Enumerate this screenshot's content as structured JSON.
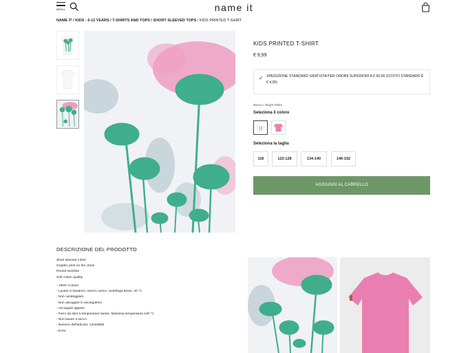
{
  "header": {
    "menu_label": "MENU",
    "logo": "name it",
    "icons": {
      "menu": "hamburger-icon",
      "search": "search-icon",
      "bag": "shopping-bag-icon"
    }
  },
  "breadcrumb": {
    "items": [
      "NAME IT",
      "KIDS - 6-12 YEARS",
      "T-SHIRTS AND TOPS",
      "SHORT SLEEVED TOPS"
    ],
    "current": "KIDS PRINTED T-SHIRT",
    "separator": " / "
  },
  "product": {
    "title": "KIDS PRINTED T-SHIRT",
    "price": "€ 9,99",
    "shipping_note": "SPEDIZIONE STANDARD GRATUITA PER ORDINI SUPERIORI A € 60,00 (COSTO STANDARD È € 4,95)",
    "color_name": "Bianco / Bright White",
    "select_color_label": "Seleziona il colore",
    "colors": [
      {
        "name": "bright-white",
        "hex": "#ffffff",
        "selected": true
      },
      {
        "name": "pink",
        "hex": "#e88ab5",
        "selected": false
      }
    ],
    "select_size_label": "Seleziona la taglia",
    "sizes": [
      "116",
      "122-128",
      "134-140",
      "146-152"
    ],
    "add_to_cart": "AGGIUNGI AL CARRELLO",
    "accent": "#6e9768"
  },
  "description": {
    "title": "DESCRIZIONE DEL PRODOTTO",
    "summary": [
      "Short sleeved t-shirt",
      "Graphic print on the chest",
      "Round neckline",
      "Soft cotton quality"
    ],
    "details": [
      "- 100% Cotone",
      "- Lavare in lavatrice, mezzo carico, centrifuga breve, 40 °C",
      "- Non candeggiare",
      "- Non asciugare in asciugatrice",
      "- Asciugare appeso",
      "- Ferro da stiro a temperature basse. Massima temperatura 100 °C",
      "- Non lavare a secco",
      "- Numero dell'articolo: 13163865",
      "- EAN:"
    ]
  },
  "colors": {
    "palm": "#3fae8c",
    "pink_wash": "#ee9ec2",
    "blue_wash": "#b8cbd2",
    "shirt_pink": "#e97fb0"
  }
}
